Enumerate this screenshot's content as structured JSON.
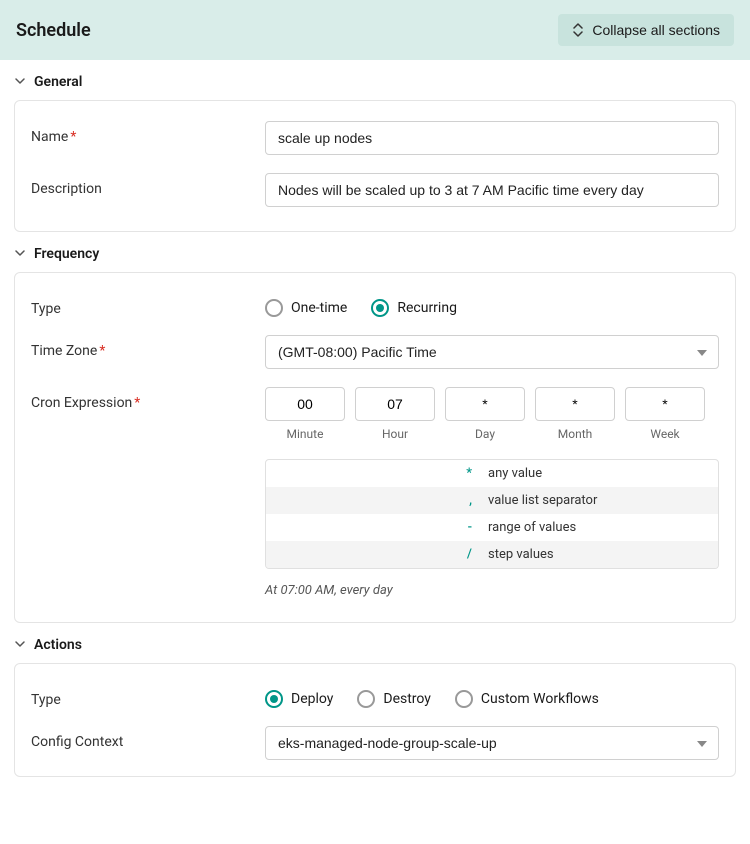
{
  "header": {
    "title": "Schedule",
    "collapse_label": "Collapse all sections"
  },
  "sections": {
    "general": {
      "title": "General",
      "name_label": "Name",
      "name_value": "scale up nodes",
      "desc_label": "Description",
      "desc_value": "Nodes will be scaled up to 3 at 7 AM Pacific time every day"
    },
    "frequency": {
      "title": "Frequency",
      "type_label": "Type",
      "type_one_time": "One-time",
      "type_recurring": "Recurring",
      "tz_label": "Time Zone",
      "tz_value": "(GMT-08:00) Pacific Time",
      "cron_label": "Cron Expression",
      "cron": {
        "minute": "00",
        "hour": "07",
        "day": "*",
        "month": "*",
        "week": "*",
        "minute_sub": "Minute",
        "hour_sub": "Hour",
        "day_sub": "Day",
        "month_sub": "Month",
        "week_sub": "Week"
      },
      "legend": [
        {
          "sym": "*",
          "desc": "any value"
        },
        {
          "sym": ",",
          "desc": "value list separator"
        },
        {
          "sym": "-",
          "desc": "range of values"
        },
        {
          "sym": "/",
          "desc": "step values"
        }
      ],
      "summary": "At 07:00 AM, every day"
    },
    "actions": {
      "title": "Actions",
      "type_label": "Type",
      "type_deploy": "Deploy",
      "type_destroy": "Destroy",
      "type_custom": "Custom Workflows",
      "config_label": "Config Context",
      "config_value": "eks-managed-node-group-scale-up"
    }
  }
}
